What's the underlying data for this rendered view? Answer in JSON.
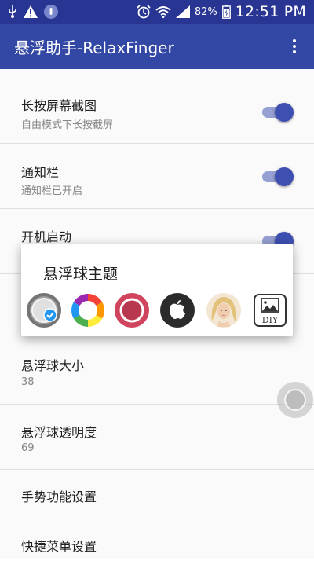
{
  "status_bar": {
    "icons_left": [
      "usb-icon",
      "warning-icon",
      "app-notification-icon"
    ],
    "icons_right": [
      "alarm-icon",
      "wifi-icon",
      "signal-icon",
      "battery-icon"
    ],
    "battery": "82%",
    "time": "12:51 PM"
  },
  "app_bar": {
    "title": "悬浮助手-RelaxFinger",
    "menu_icon": "more-vert-icon"
  },
  "settings": {
    "long_press_screenshot": {
      "title": "长按屏幕截图",
      "subtitle": "自由模式下长按截屏",
      "enabled": true
    },
    "notification_bar": {
      "title": "通知栏",
      "subtitle": "通知栏已开启",
      "enabled": true
    },
    "boot_start": {
      "title": "开机启动",
      "enabled": true
    },
    "ball_size": {
      "title": "悬浮球大小",
      "value": "38"
    },
    "ball_opacity": {
      "title": "悬浮球透明度",
      "value": "69"
    },
    "gesture_settings": {
      "title": "手势功能设置"
    },
    "quick_menu_settings": {
      "title": "快捷菜单设置"
    }
  },
  "theme_dialog": {
    "title": "悬浮球主题",
    "themes": [
      {
        "id": "theme-default",
        "icon": "gray-ring-ball-icon",
        "selected": true
      },
      {
        "id": "theme-color-wheel",
        "icon": "color-wheel-icon",
        "selected": false
      },
      {
        "id": "theme-red-ring",
        "icon": "red-ring-icon",
        "selected": false
      },
      {
        "id": "theme-apple",
        "icon": "apple-logo-icon",
        "selected": false
      },
      {
        "id": "theme-photo",
        "icon": "portrait-photo-icon",
        "selected": false
      },
      {
        "id": "theme-diy",
        "icon": "diy-image-icon",
        "label": "DIY",
        "selected": false
      }
    ]
  },
  "colors": {
    "status_bar": "#283593",
    "app_bar": "#3347a4",
    "accent": "#3f51b5",
    "accent_track": "#9aa4d8"
  }
}
